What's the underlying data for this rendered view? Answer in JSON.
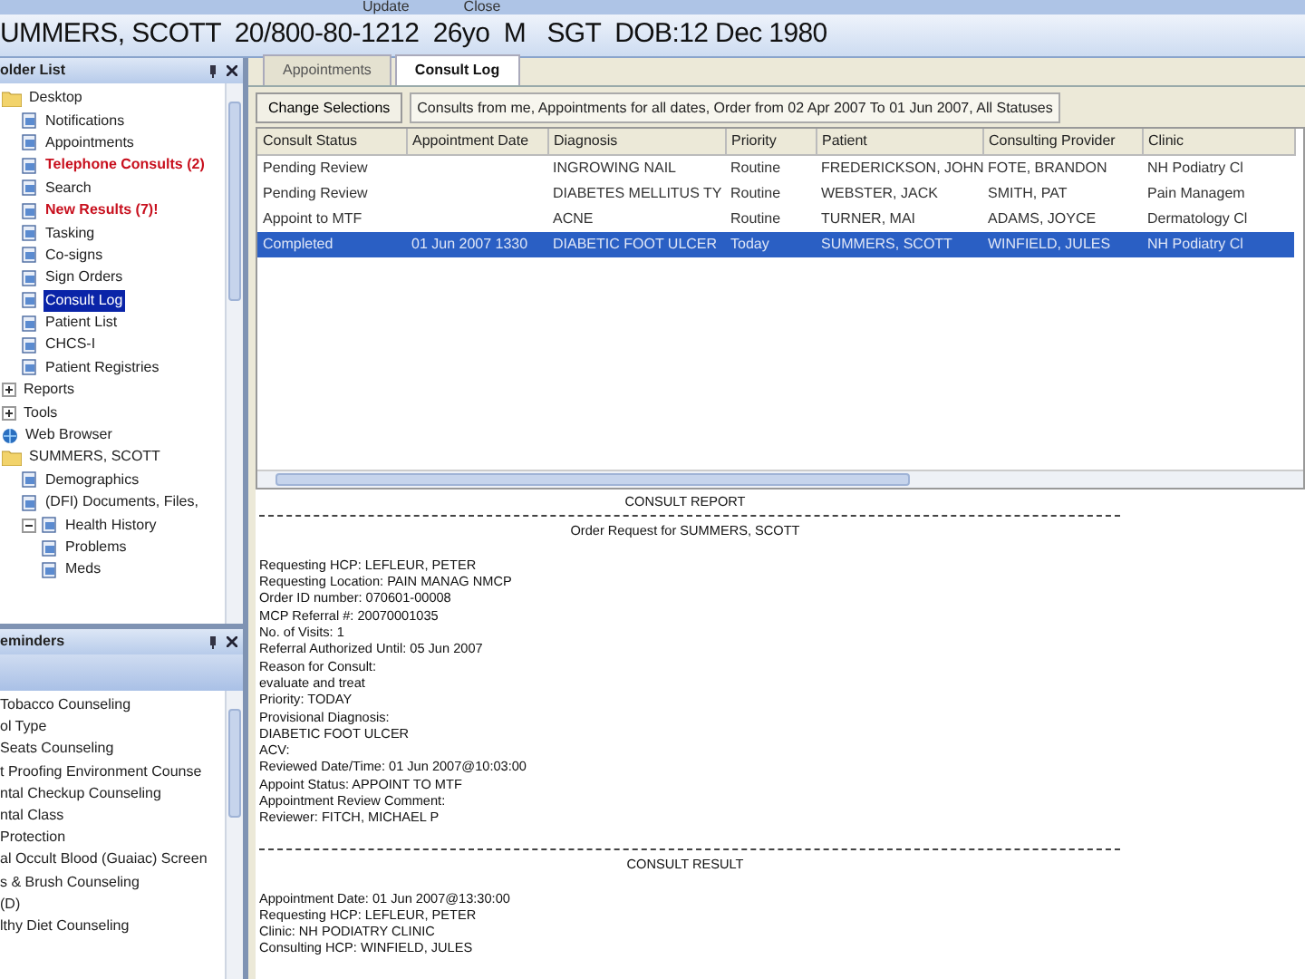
{
  "menu": [
    "Update",
    "Close"
  ],
  "patient_header": "UMMERS, SCOTT  20/800-80-1212  26yo  M   SGT  DOB:12 Dec 1980",
  "folder_list": {
    "title": "older List",
    "items": [
      {
        "label": "Desktop",
        "kind": "folder",
        "alert": false,
        "selected": false,
        "expanded": true,
        "children": [
          {
            "label": "Notifications",
            "kind": "item",
            "alert": false,
            "selected": false
          },
          {
            "label": "Appointments",
            "kind": "item",
            "alert": false,
            "selected": false
          },
          {
            "label": "Telephone Consults (2)",
            "kind": "item",
            "alert": true,
            "selected": false
          },
          {
            "label": "Search",
            "kind": "item",
            "alert": false,
            "selected": false
          },
          {
            "label": "New Results (7)!",
            "kind": "item",
            "alert": true,
            "selected": false
          },
          {
            "label": "Tasking",
            "kind": "item",
            "alert": false,
            "selected": false
          },
          {
            "label": "Co-signs",
            "kind": "item",
            "alert": false,
            "selected": false
          },
          {
            "label": "Sign Orders",
            "kind": "item",
            "alert": false,
            "selected": false
          },
          {
            "label": "Consult Log",
            "kind": "item",
            "alert": false,
            "selected": true
          },
          {
            "label": "Patient List",
            "kind": "item",
            "alert": false,
            "selected": false
          },
          {
            "label": "CHCS-I",
            "kind": "item",
            "alert": false,
            "selected": false
          },
          {
            "label": "Patient Registries",
            "kind": "item",
            "alert": false,
            "selected": false
          }
        ]
      },
      {
        "label": "Reports",
        "kind": "group",
        "alert": false,
        "selected": false,
        "expanded": false
      },
      {
        "label": "Tools",
        "kind": "group",
        "alert": false,
        "selected": false,
        "expanded": false
      },
      {
        "label": "Web Browser",
        "kind": "globe",
        "alert": false,
        "selected": false
      },
      {
        "label": "SUMMERS, SCOTT",
        "kind": "folder",
        "alert": false,
        "selected": false,
        "expanded": true,
        "children": [
          {
            "label": "Demographics",
            "kind": "item",
            "alert": false,
            "selected": false
          },
          {
            "label": "(DFI) Documents, Files,",
            "kind": "item",
            "alert": false,
            "selected": false
          },
          {
            "label": "Health History",
            "kind": "item",
            "alert": false,
            "selected": false,
            "expanded": true,
            "children": [
              {
                "label": "Problems",
                "kind": "item",
                "alert": false,
                "selected": false
              },
              {
                "label": "Meds",
                "kind": "item",
                "alert": false,
                "selected": false
              }
            ]
          }
        ]
      }
    ]
  },
  "reminders": {
    "title": "eminders",
    "items": [
      "Tobacco Counseling",
      "ol Type",
      "Seats Counseling",
      "t Proofing Environment Counse",
      "ntal Checkup Counseling",
      "ntal Class",
      "Protection",
      "al Occult Blood (Guaiac) Screen",
      "s & Brush Counseling",
      "(D)",
      "lthy Diet Counseling"
    ]
  },
  "tabs": [
    {
      "label": "Appointments",
      "selected": false
    },
    {
      "label": "Consult Log",
      "selected": true
    }
  ],
  "change_button": "Change Selections",
  "filter": "Consults from me, Appointments for all dates, Order from 02 Apr 2007 To 01 Jun 2007, All Statuses",
  "table": {
    "columns": [
      "Consult Status",
      "Appointment Date",
      "Diagnosis",
      "Priority",
      "Patient",
      "Consulting Provider",
      "Clinic"
    ],
    "rows": [
      {
        "cells": [
          "Pending Review",
          "",
          "INGROWING NAIL",
          "Routine",
          "FREDERICKSON, JOHN",
          "FOTE, BRANDON",
          "NH Podiatry Cl"
        ],
        "selected": false
      },
      {
        "cells": [
          "Pending Review",
          "",
          "DIABETES MELLITUS TY",
          "Routine",
          "WEBSTER, JACK",
          "SMITH, PAT",
          "Pain Managem"
        ],
        "selected": false
      },
      {
        "cells": [
          "Appoint to MTF",
          "",
          "ACNE",
          "Routine",
          "TURNER, MAI",
          "ADAMS, JOYCE",
          "Dermatology Cl"
        ],
        "selected": false
      },
      {
        "cells": [
          "Completed",
          "01 Jun 2007 1330",
          "DIABETIC FOOT ULCER",
          "Today",
          "SUMMERS, SCOTT",
          "WINFIELD, JULES",
          "NH Podiatry Cl"
        ],
        "selected": true
      }
    ]
  },
  "report": [
    {
      "kind": "heading",
      "text": "CONSULT REPORT"
    },
    {
      "kind": "rule"
    },
    {
      "kind": "center",
      "text": "Order Request for SUMMERS, SCOTT"
    },
    {
      "kind": "blank"
    },
    {
      "kind": "line",
      "text": "Requesting HCP:  LEFLEUR, PETER"
    },
    {
      "kind": "line",
      "text": "Requesting Location:  PAIN MANAG NMCP"
    },
    {
      "kind": "line",
      "text": "Order ID number:  070601-00008"
    },
    {
      "kind": "line",
      "text": "MCP Referral #:  20070001035"
    },
    {
      "kind": "line",
      "text": "No. of Visits:  1"
    },
    {
      "kind": "line",
      "text": "Referral Authorized Until:  05 Jun 2007"
    },
    {
      "kind": "line",
      "text": "Reason for Consult:"
    },
    {
      "kind": "line",
      "text": "evaluate and treat"
    },
    {
      "kind": "line",
      "text": "Priority:  TODAY"
    },
    {
      "kind": "line",
      "text": "Provisional Diagnosis:"
    },
    {
      "kind": "line",
      "text": "DIABETIC FOOT ULCER"
    },
    {
      "kind": "line",
      "text": "ACV:"
    },
    {
      "kind": "line",
      "text": "Reviewed Date/Time:  01 Jun 2007@10:03:00"
    },
    {
      "kind": "line",
      "text": "Appoint Status:  APPOINT TO MTF"
    },
    {
      "kind": "line",
      "text": "Appointment Review Comment:"
    },
    {
      "kind": "line",
      "text": "Reviewer:  FITCH, MICHAEL P"
    },
    {
      "kind": "blank"
    },
    {
      "kind": "rule"
    },
    {
      "kind": "heading",
      "text": "CONSULT RESULT"
    },
    {
      "kind": "blank"
    },
    {
      "kind": "line",
      "text": "Appointment Date:  01 Jun 2007@13:30:00"
    },
    {
      "kind": "line",
      "text": "Requesting HCP:  LEFLEUR, PETER"
    },
    {
      "kind": "line",
      "text": "Clinic:  NH PODIATRY CLINIC"
    },
    {
      "kind": "line",
      "text": "Consulting HCP:  WINFIELD, JULES"
    }
  ]
}
